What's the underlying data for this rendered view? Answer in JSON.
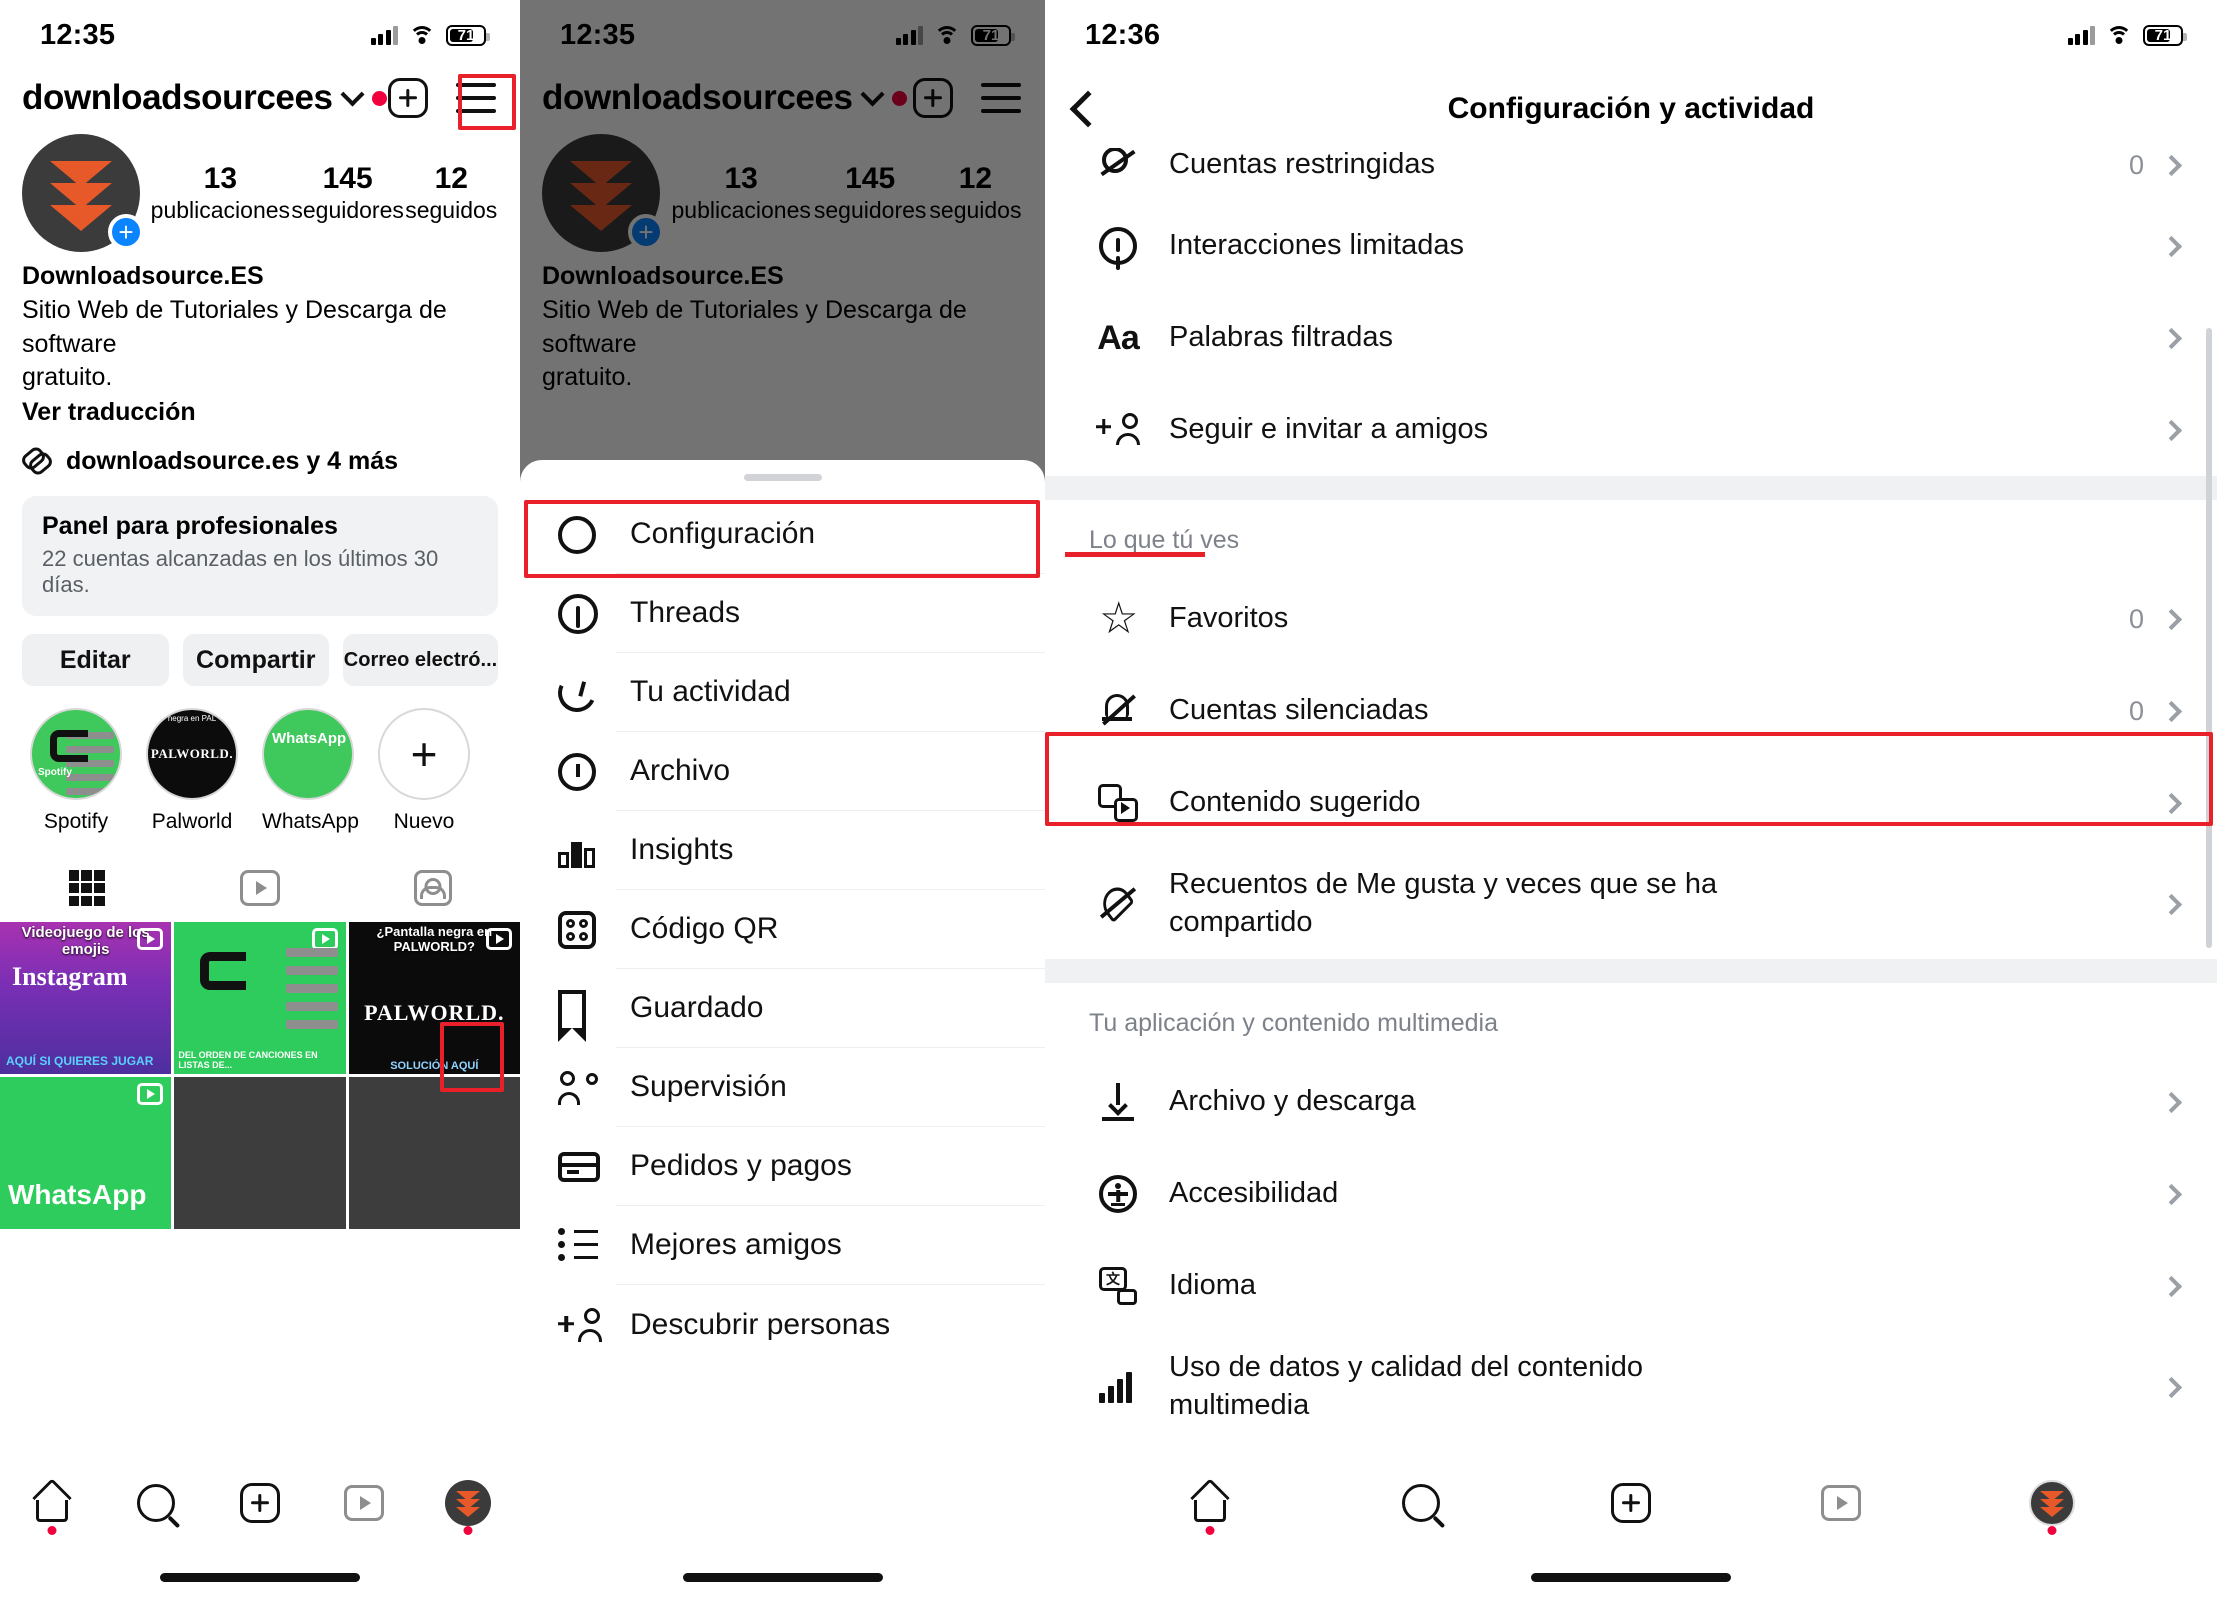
{
  "panel1": {
    "status": {
      "time": "12:35",
      "battery": "71"
    },
    "profile": {
      "username": "downloadsourcees",
      "stats": [
        {
          "number": "13",
          "label": "publicaciones"
        },
        {
          "number": "145",
          "label": "seguidores"
        },
        {
          "number": "12",
          "label": "seguidos"
        }
      ],
      "display_name": "Downloadsource.ES",
      "bio_line1": "Sitio Web de Tutoriales y Descarga de software",
      "bio_line2": "gratuito.",
      "translate_link": "Ver traducción",
      "link_text": "downloadsource.es y 4 más"
    },
    "pro_card": {
      "title": "Panel para profesionales",
      "subtitle": "22 cuentas alcanzadas en los últimos 30 días."
    },
    "buttons": {
      "edit": "Editar",
      "share": "Compartir",
      "email": "Correo electró..."
    },
    "highlights": [
      {
        "label": "Spotify"
      },
      {
        "label": "Palworld"
      },
      {
        "label": "WhatsApp"
      },
      {
        "label": "Nuevo"
      }
    ],
    "grid": [
      {
        "caption": "Videojuego de los emojis",
        "sub": "AQUÍ SI QUIERES JUGAR",
        "logo": "Instagram"
      },
      {
        "caption": "",
        "sub": "DEL ORDEN DE CANCIONES EN LISTAS DE..."
      },
      {
        "caption": "¿Pantalla negra en PALWORLD?",
        "sub": "SOLUCIÓN AQUÍ",
        "logo": "PALWORLD."
      },
      {
        "caption": "",
        "logo": "WhatsApp"
      },
      {
        "caption": ""
      },
      {
        "caption": ""
      }
    ]
  },
  "panel2": {
    "status": {
      "time": "12:35",
      "battery": "71"
    },
    "menu": [
      {
        "label": "Configuración",
        "icon": "gear-icon",
        "highlighted": true
      },
      {
        "label": "Threads",
        "icon": "threads-icon"
      },
      {
        "label": "Tu actividad",
        "icon": "activity-icon"
      },
      {
        "label": "Archivo",
        "icon": "archive-clock-icon"
      },
      {
        "label": "Insights",
        "icon": "insights-bars-icon"
      },
      {
        "label": "Código QR",
        "icon": "qr-code-icon"
      },
      {
        "label": "Guardado",
        "icon": "bookmark-icon"
      },
      {
        "label": "Supervisión",
        "icon": "people-icon"
      },
      {
        "label": "Pedidos y pagos",
        "icon": "credit-card-icon"
      },
      {
        "label": "Mejores amigos",
        "icon": "best-friends-list-icon"
      },
      {
        "label": "Descubrir personas",
        "icon": "add-person-icon"
      }
    ]
  },
  "panel3": {
    "status": {
      "time": "12:36",
      "battery": "71"
    },
    "header_title": "Configuración y actividad",
    "items_top": [
      {
        "label": "Cuentas restringidas",
        "value": "0",
        "icon": "restricted-accounts-icon",
        "cut": true
      },
      {
        "label": "Interacciones limitadas",
        "value": "",
        "icon": "limited-interactions-icon"
      },
      {
        "label": "Palabras filtradas",
        "value": "",
        "icon": "aa-text-icon"
      },
      {
        "label": "Seguir e invitar a amigos",
        "value": "",
        "icon": "follow-invite-icon"
      }
    ],
    "section_what_you_see": {
      "header": "Lo que tú ves",
      "items": [
        {
          "label": "Favoritos",
          "value": "0",
          "icon": "star-icon"
        },
        {
          "label": "Cuentas silenciadas",
          "value": "0",
          "icon": "bell-muted-icon"
        },
        {
          "label": "Contenido sugerido",
          "value": "",
          "icon": "suggested-content-icon",
          "highlighted": true
        },
        {
          "label": "Recuentos de Me gusta y veces que se ha compartido",
          "value": "",
          "icon": "heart-slash-icon"
        }
      ]
    },
    "section_app_media": {
      "header": "Tu aplicación y contenido multimedia",
      "items": [
        {
          "label": "Archivo y descarga",
          "value": "",
          "icon": "download-icon"
        },
        {
          "label": "Accesibilidad",
          "value": "",
          "icon": "accessibility-icon"
        },
        {
          "label": "Idioma",
          "value": "",
          "icon": "language-icon"
        },
        {
          "label": "Uso de datos y calidad del contenido multimedia",
          "value": "",
          "icon": "data-bars-icon"
        }
      ]
    }
  },
  "colors": {
    "accent_red": "#e8202a",
    "notification_red": "#f0003c",
    "brand_orange": "#e8592a",
    "blue_plus": "#0a84ff",
    "green": "#2ecc5c"
  }
}
